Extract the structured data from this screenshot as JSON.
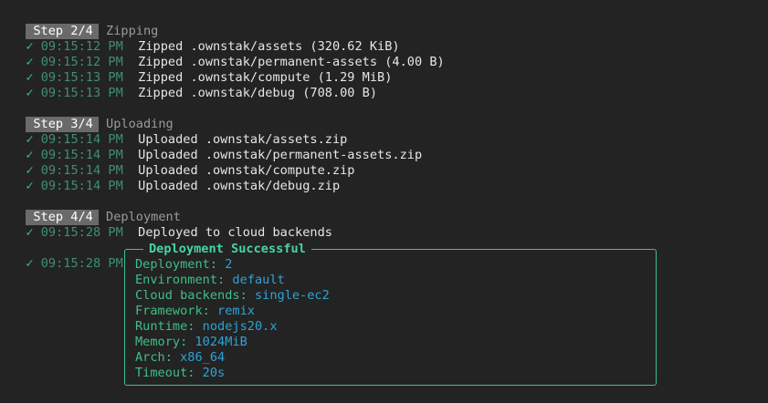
{
  "steps": [
    {
      "badge": "Step 2/4",
      "name": "Zipping",
      "lines": [
        {
          "check": "✓",
          "time": "09:15:12 PM",
          "msg": "Zipped .ownstak/assets (320.62 KiB)"
        },
        {
          "check": "✓",
          "time": "09:15:12 PM",
          "msg": "Zipped .ownstak/permanent-assets (4.00 B)"
        },
        {
          "check": "✓",
          "time": "09:15:13 PM",
          "msg": "Zipped .ownstak/compute (1.29 MiB)"
        },
        {
          "check": "✓",
          "time": "09:15:13 PM",
          "msg": "Zipped .ownstak/debug (708.00 B)"
        }
      ]
    },
    {
      "badge": "Step 3/4",
      "name": "Uploading",
      "lines": [
        {
          "check": "✓",
          "time": "09:15:14 PM",
          "msg": "Uploaded .ownstak/assets.zip"
        },
        {
          "check": "✓",
          "time": "09:15:14 PM",
          "msg": "Uploaded .ownstak/permanent-assets.zip"
        },
        {
          "check": "✓",
          "time": "09:15:14 PM",
          "msg": "Uploaded .ownstak/compute.zip"
        },
        {
          "check": "✓",
          "time": "09:15:14 PM",
          "msg": "Uploaded .ownstak/debug.zip"
        }
      ]
    },
    {
      "badge": "Step 4/4",
      "name": "Deployment",
      "lines": [
        {
          "check": "✓",
          "time": "09:15:28 PM",
          "msg": "Deployed to cloud backends"
        }
      ]
    }
  ],
  "final": {
    "check": "✓",
    "time": "09:15:28 PM",
    "box_title": "Deployment Successful",
    "fields": [
      {
        "key": "Deployment:",
        "value": "2"
      },
      {
        "key": "Environment:",
        "value": "default"
      },
      {
        "key": "Cloud backends:",
        "value": "single-ec2"
      },
      {
        "key": "Framework:",
        "value": "remix"
      },
      {
        "key": "Runtime:",
        "value": "nodejs20.x"
      },
      {
        "key": "Memory:",
        "value": "1024MiB"
      },
      {
        "key": "Arch:",
        "value": "x86_64"
      },
      {
        "key": "Timeout:",
        "value": "20s"
      }
    ]
  },
  "colors": {
    "background": "#232323",
    "check": "#3dbf83",
    "timestamp": "#3f8f70",
    "box_border": "#3dbf93",
    "key": "#3fbf86",
    "value": "#2ea3d6"
  }
}
